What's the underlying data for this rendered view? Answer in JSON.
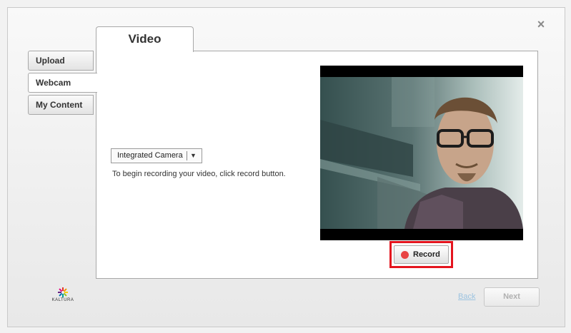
{
  "dialog": {
    "close_label": "×"
  },
  "sidebar": {
    "items": [
      {
        "label": "Upload"
      },
      {
        "label": "Webcam"
      },
      {
        "label": "My Content"
      }
    ]
  },
  "main_tab": {
    "label": "Video"
  },
  "camera": {
    "selected": "Integrated Camera",
    "instruction": "To begin recording your video, click record button."
  },
  "record": {
    "label": "Record",
    "accent": "#e4141e"
  },
  "footer": {
    "logo_text": "KALTURA",
    "back_label": "Back",
    "next_label": "Next"
  }
}
